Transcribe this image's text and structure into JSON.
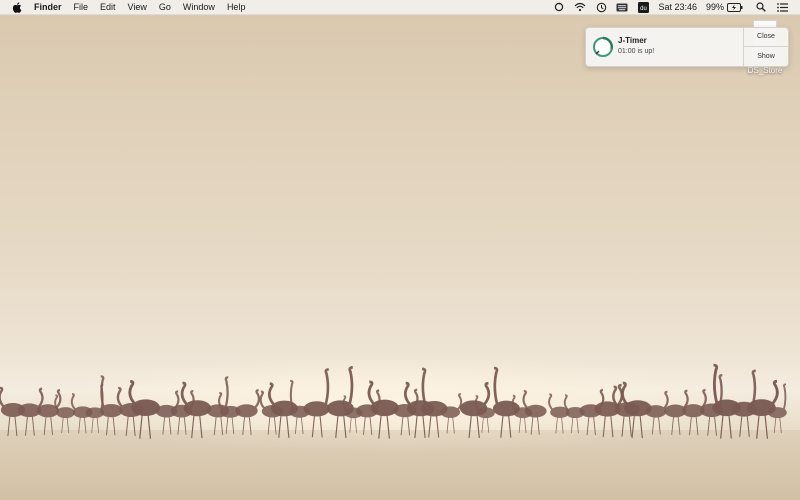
{
  "menubar": {
    "app_name": "Finder",
    "menus": [
      "File",
      "Edit",
      "View",
      "Go",
      "Window",
      "Help"
    ],
    "status": {
      "clock": "Sat 23:46",
      "battery": "99%",
      "icons": [
        "sync-icon",
        "wifi-icon",
        "time-machine-icon",
        "keyboard-icon",
        "dictionary-icon",
        "battery-icon",
        "spotlight-icon",
        "notification-center-icon"
      ]
    }
  },
  "desktop": {
    "file_label": "DS_Store",
    "wallpaper": "flamingos at sunrise"
  },
  "notification": {
    "app": "J-Timer",
    "message": "01:00 is up!",
    "close_label": "Close",
    "show_label": "Show"
  },
  "colors": {
    "accent": "#3a9a7a",
    "menubar_bg": "#f2f0ed",
    "wallpaper_sky": "#d9c8ae",
    "wallpaper_glow": "#fff3df",
    "flamingo": "#7a5a52"
  }
}
